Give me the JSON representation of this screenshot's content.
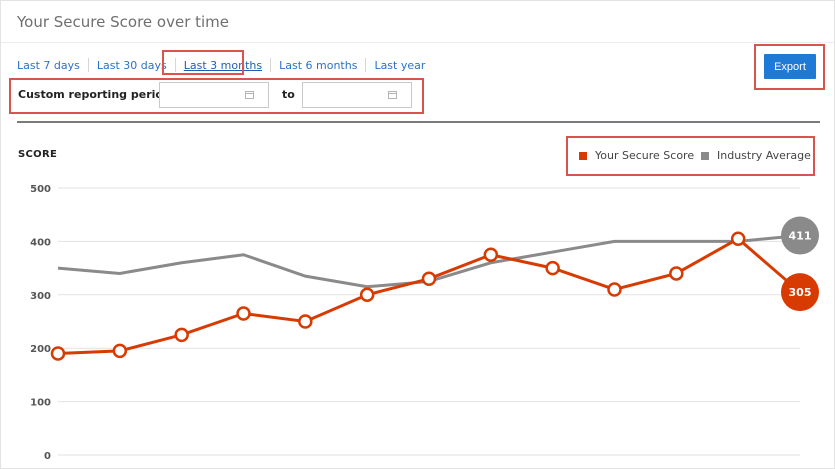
{
  "header": {
    "title": "Your Secure Score over time"
  },
  "range_links": [
    {
      "label": "Last 7 days",
      "active": false
    },
    {
      "label": "Last 30 days",
      "active": false
    },
    {
      "label": "Last 3 months",
      "active": true
    },
    {
      "label": "Last 6 months",
      "active": false
    },
    {
      "label": "Last year",
      "active": false
    }
  ],
  "export_label": "Export",
  "custom_period": {
    "label": "Custom reporting period:",
    "to_label": "to",
    "from_value": "",
    "to_value": ""
  },
  "colors": {
    "accent": "#1f7ad6",
    "secure_score": "#d83b01",
    "industry": "#8a8a8a",
    "highlight": "#d9534f"
  },
  "chart_data": {
    "type": "line",
    "ylabel": "SCORE",
    "ylim": [
      0,
      500
    ],
    "yticks": [
      0,
      100,
      200,
      300,
      400,
      500
    ],
    "x": [
      0,
      1,
      2,
      3,
      4,
      5,
      6,
      7,
      8,
      9,
      10,
      11,
      12
    ],
    "series": [
      {
        "name": "Your Secure Score",
        "color": "#d83b01",
        "values": [
          190,
          195,
          225,
          265,
          250,
          300,
          330,
          375,
          350,
          310,
          340,
          405,
          305
        ],
        "last_label": "305"
      },
      {
        "name": "Industry Average",
        "color": "#8a8a8a",
        "values": [
          350,
          340,
          360,
          375,
          335,
          315,
          325,
          360,
          380,
          400,
          400,
          400,
          411
        ],
        "last_label": "411"
      }
    ]
  }
}
